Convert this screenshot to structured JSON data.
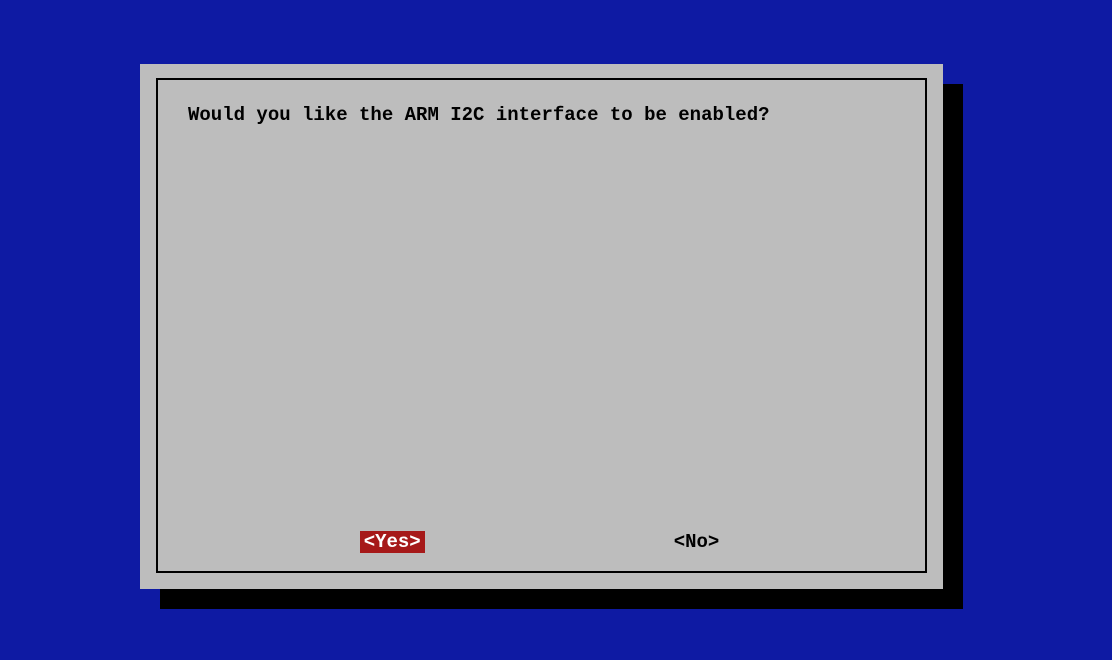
{
  "dialog": {
    "message": "Would you like the ARM I2C interface to be enabled?",
    "buttons": {
      "yes": "<Yes>",
      "no": "<No>"
    },
    "selected": "yes"
  },
  "colors": {
    "background": "#0e1aa3",
    "dialog_bg": "#bdbdbd",
    "shadow": "#000000",
    "border": "#000000",
    "text": "#000000",
    "selected_bg": "#a61919",
    "selected_text": "#ffffff"
  }
}
